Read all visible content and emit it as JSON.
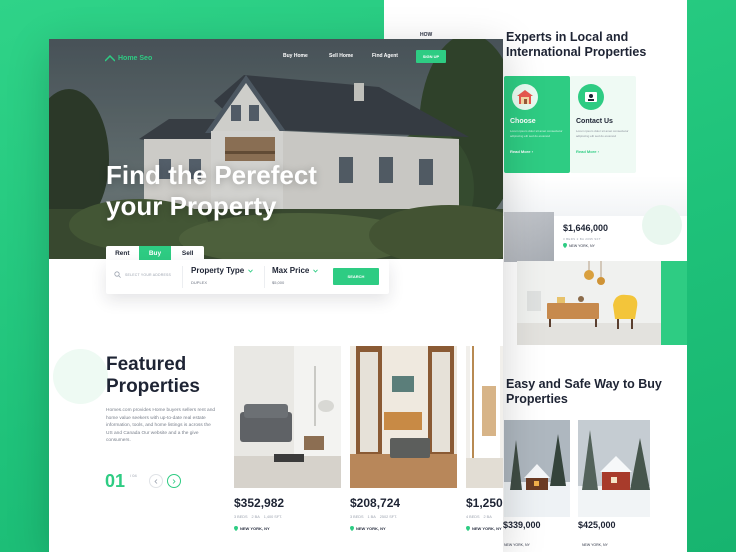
{
  "colors": {
    "accent": "#2ecc83",
    "text_dark": "#1e2434",
    "muted": "#9aa1ad",
    "background": "#22c77e"
  },
  "back_page": {
    "nav_item": "HOW",
    "nav_sub": "IT WORKS",
    "experts_heading": "Experts in Local and International Properties",
    "services": [
      {
        "title": "Choose",
        "icon": "house-icon",
        "description": "Lorem ipsum dolor sit amet consectetur adipiscing elit sed do eiusmod",
        "link": "Read More"
      },
      {
        "title": "Contact Us",
        "icon": "agent-icon",
        "description": "Lorem ipsum dolor sit amet consectetur adipiscing elit sed do eiusmod",
        "link": "Read More"
      }
    ],
    "listing": {
      "price": "$1,646,000",
      "specs": "3 BEDS   2 BA   2095 SFT",
      "location": "NEW YORK, NY"
    },
    "guide_heading": "Easy and Safe Way to Buy Properties",
    "cabins": [
      {
        "price": "$339,000",
        "location": "NEW YORK, NY"
      },
      {
        "price": "$425,000",
        "location": "NEW YORK, NY"
      }
    ]
  },
  "nav": {
    "logo": "Home Seo",
    "links": [
      "Buy Home",
      "Sell Home",
      "Find Agent"
    ],
    "signup": "SIGN UP"
  },
  "hero": {
    "title": "Find the Perefect your Property"
  },
  "search": {
    "tabs": [
      {
        "label": "Rent",
        "active": false
      },
      {
        "label": "Buy",
        "active": true
      },
      {
        "label": "Sell",
        "active": false
      }
    ],
    "placeholder": "SELECT YOUR ADDRESS",
    "property_type_label": "Property Type",
    "property_type_value": "DUPLEX",
    "max_price_label": "Max Price",
    "max_price_value": "$5,000",
    "button": "SEARCH"
  },
  "featured": {
    "title": "Featured Properties",
    "description": "Homes.com provides Home buyers sellers rent and home value seekers with up-to-date real estate information, tools, and home listings is across the US and Canada Our website and a the give consumers.",
    "pager_current": "01",
    "pager_total": "/ 04",
    "properties": [
      {
        "price": "$352,982",
        "beds": "3 BEDS",
        "baths": "2 BA",
        "area": "1,400 SFT.",
        "location": "NEW YORK, NY"
      },
      {
        "price": "$208,724",
        "beds": "3 BEDS",
        "baths": "1 BA",
        "area": "2502 SFT.",
        "location": "NEW YORK, NY"
      },
      {
        "price": "$1,250,",
        "beds": "4 BEDS",
        "baths": "2 BA",
        "area": "",
        "location": "NEW YORK, NY"
      }
    ]
  }
}
